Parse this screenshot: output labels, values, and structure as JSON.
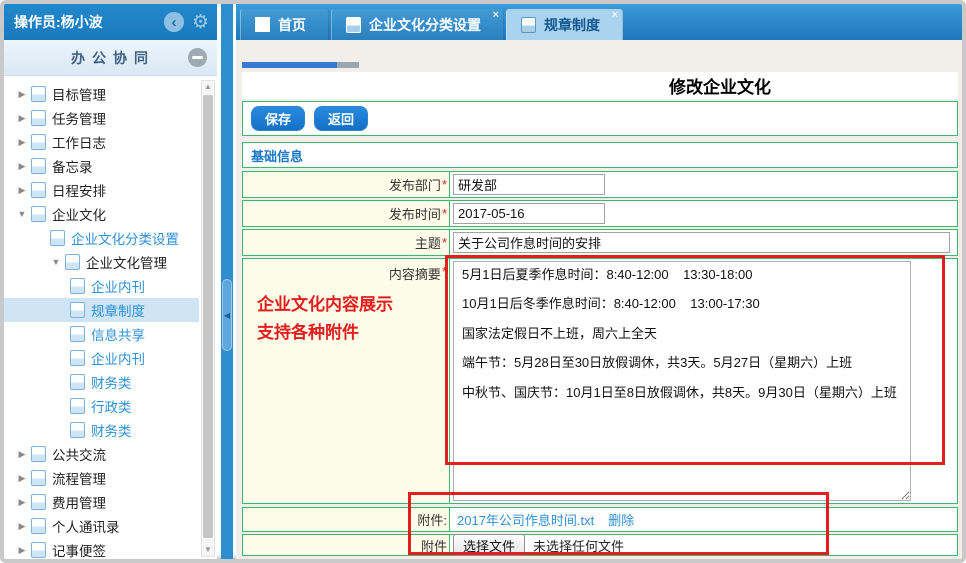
{
  "colors": {
    "header_blue": "#1d7fc4",
    "accent_blue": "#2e8fd0",
    "green_border": "#3cb96e",
    "label_yellow": "#fcfce8",
    "annotation_red": "#e41e1e",
    "link_blue": "#2b91d8"
  },
  "header": {
    "operator": "操作员:杨小波"
  },
  "sidebar": {
    "title": "办公协同",
    "tree": [
      {
        "label": "目标管理",
        "indent": 0,
        "arrow": "right",
        "link": false,
        "selected": false
      },
      {
        "label": "任务管理",
        "indent": 0,
        "arrow": "right",
        "link": false,
        "selected": false
      },
      {
        "label": "工作日志",
        "indent": 0,
        "arrow": "right",
        "link": false,
        "selected": false
      },
      {
        "label": "备忘录",
        "indent": 0,
        "arrow": "right",
        "link": false,
        "selected": false
      },
      {
        "label": "日程安排",
        "indent": 0,
        "arrow": "right",
        "link": false,
        "selected": false
      },
      {
        "label": "企业文化",
        "indent": 0,
        "arrow": "down",
        "link": false,
        "selected": false
      },
      {
        "label": "企业文化分类设置",
        "indent": 1,
        "arrow": "none",
        "link": true,
        "selected": false
      },
      {
        "label": "企业文化管理",
        "indent": 1,
        "arrow": "down",
        "link": false,
        "selected": false
      },
      {
        "label": "企业内刊",
        "indent": 2,
        "arrow": "none",
        "link": true,
        "selected": false
      },
      {
        "label": "规章制度",
        "indent": 2,
        "arrow": "none",
        "link": true,
        "selected": true
      },
      {
        "label": "信息共享",
        "indent": 2,
        "arrow": "none",
        "link": true,
        "selected": false
      },
      {
        "label": "企业内刊",
        "indent": 2,
        "arrow": "none",
        "link": true,
        "selected": false
      },
      {
        "label": "财务类",
        "indent": 2,
        "arrow": "none",
        "link": true,
        "selected": false
      },
      {
        "label": "行政类",
        "indent": 2,
        "arrow": "none",
        "link": true,
        "selected": false
      },
      {
        "label": "财务类",
        "indent": 2,
        "arrow": "none",
        "link": true,
        "selected": false
      },
      {
        "label": "公共交流",
        "indent": 0,
        "arrow": "right",
        "link": false,
        "selected": false
      },
      {
        "label": "流程管理",
        "indent": 0,
        "arrow": "right",
        "link": false,
        "selected": false
      },
      {
        "label": "费用管理",
        "indent": 0,
        "arrow": "right",
        "link": false,
        "selected": false
      },
      {
        "label": "个人通讯录",
        "indent": 0,
        "arrow": "right",
        "link": false,
        "selected": false
      },
      {
        "label": "记事便签",
        "indent": 0,
        "arrow": "right",
        "link": false,
        "selected": false
      }
    ]
  },
  "tabs": [
    {
      "label": "首页",
      "icon": "home",
      "closable": false,
      "active": false
    },
    {
      "label": "企业文化分类设置",
      "icon": "doc",
      "closable": true,
      "active": false
    },
    {
      "label": "规章制度",
      "icon": "doc",
      "closable": true,
      "active": true
    }
  ],
  "page": {
    "title": "修改企业文化"
  },
  "toolbar": {
    "save": "保存",
    "back": "返回"
  },
  "section": {
    "title": "基础信息"
  },
  "form": {
    "required_marker": "*",
    "rows": [
      {
        "label": "发布部门",
        "value": "研发部"
      },
      {
        "label": "发布时间",
        "value": "2017-05-16"
      },
      {
        "label": "主题",
        "value": "关于公司作息时间的安排"
      },
      {
        "label": "内容摘要"
      }
    ],
    "content": "5月1日后夏季作息时间：8:40-12:00    13:30-18:00\n\n10月1日后冬季作息时间：8:40-12:00    13:00-17:30\n\n国家法定假日不上班，周六上全天\n\n端午节：5月28日至30日放假调休，共3天。5月27日（星期六）上班\n\n中秋节、国庆节：10月1日至8日放假调休，共8天。9月30日（星期六）上班",
    "annotation": "企业文化内容展示\n支持各种附件",
    "attachment": {
      "label": "附件:",
      "file_name": "2017年公司作息时间.txt",
      "delete_label": "删除"
    },
    "upload": {
      "label": "附件",
      "button": "选择文件",
      "status": "未选择任何文件"
    }
  }
}
